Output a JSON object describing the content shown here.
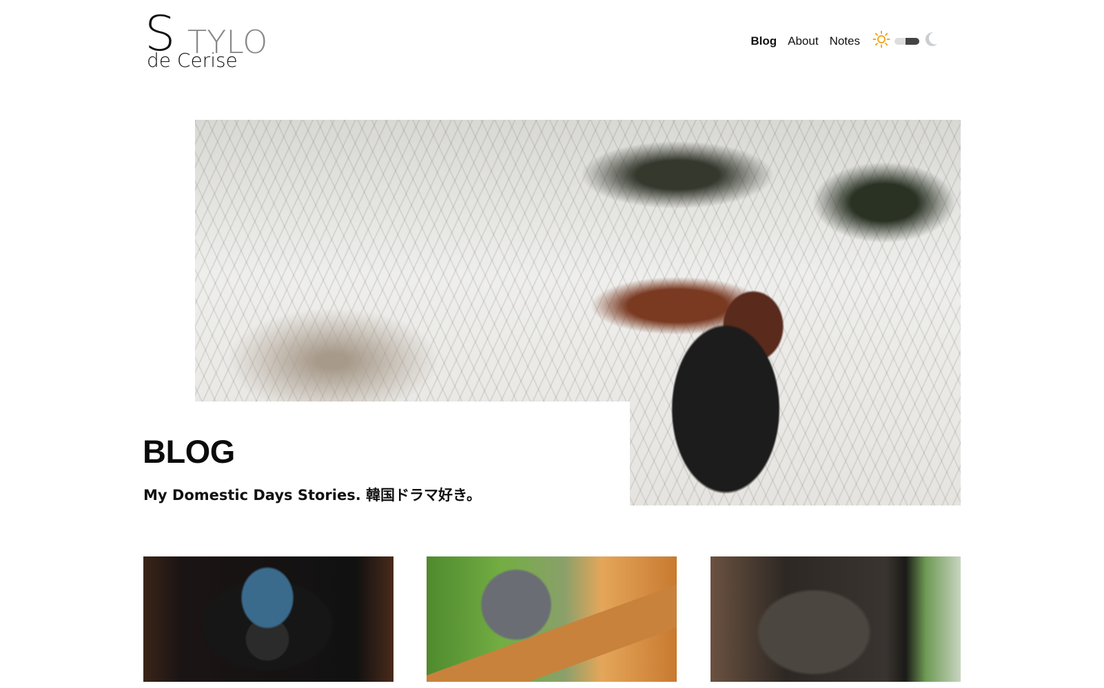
{
  "header": {
    "logo": {
      "big_letter": "S",
      "rest": "TYLO",
      "sub": "de Cerise"
    },
    "nav": [
      {
        "label": "Blog",
        "active": true
      },
      {
        "label": "About",
        "active": false
      },
      {
        "label": "Notes",
        "active": false
      }
    ],
    "theme_toggle": {
      "light_icon": "sun-icon",
      "dark_icon": "moon-icon",
      "state": "light"
    }
  },
  "hero": {
    "title": "BLOG",
    "subtitle": "My Domestic Days Stories. 韓国ドラマ好き。"
  },
  "posts": [
    {
      "image": "t-shirt-photo"
    },
    {
      "image": "cat-in-ivy-photo"
    },
    {
      "image": "fluffy-cat-photo"
    }
  ],
  "colors": {
    "accent_sun": "#f0a81c",
    "moon": "#c9ced2",
    "text": "#111111"
  }
}
